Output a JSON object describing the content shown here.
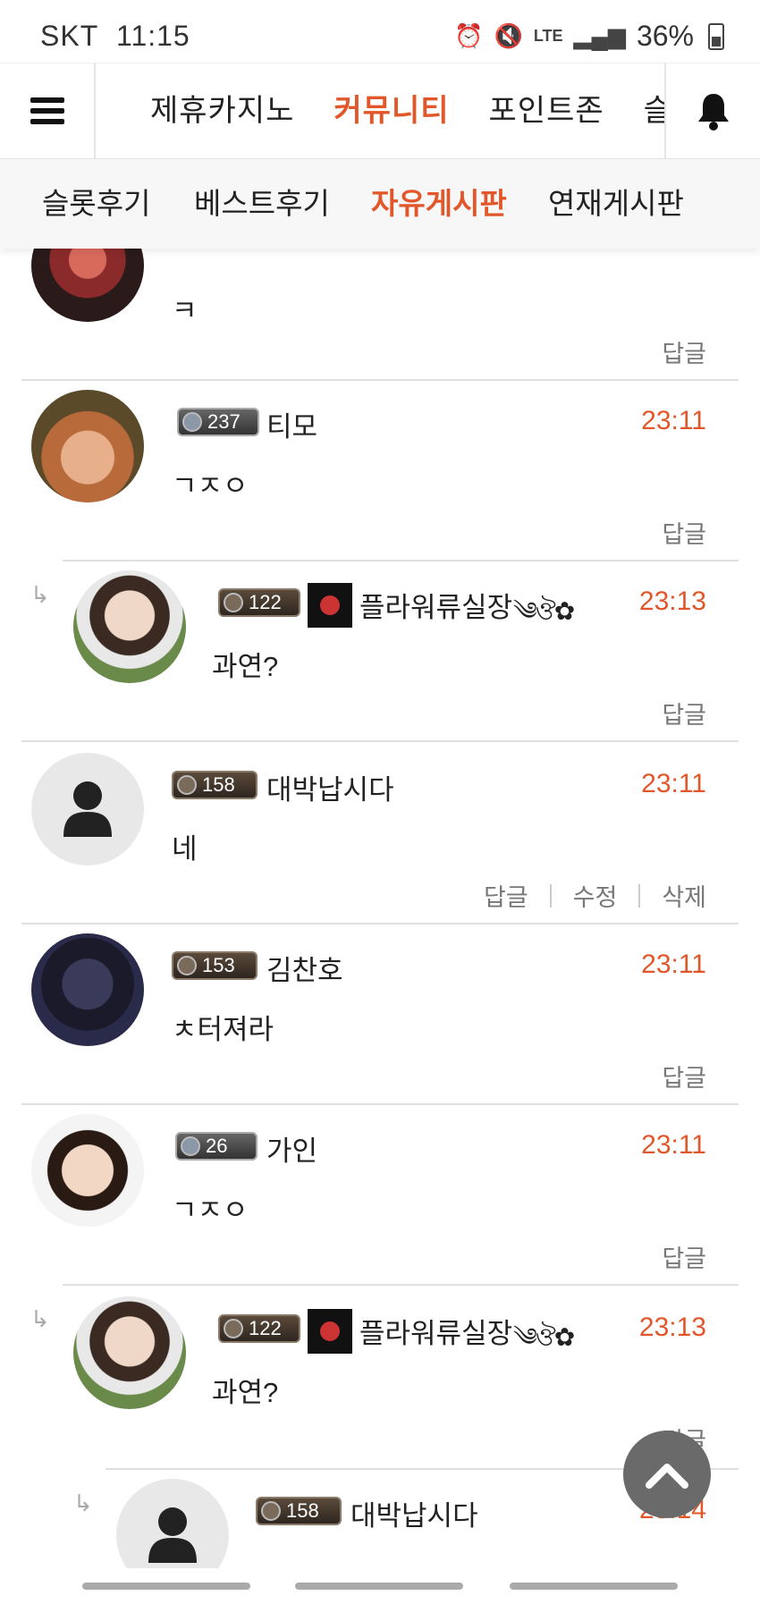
{
  "status_bar": {
    "carrier": "SKT",
    "time": "11:15",
    "battery": "36%",
    "network": "LTE"
  },
  "top_nav": {
    "items": [
      {
        "label": "제휴카지노",
        "active": false
      },
      {
        "label": "커뮤니티",
        "active": true
      },
      {
        "label": "포인트존",
        "active": false
      },
      {
        "label": "슬",
        "active": false
      }
    ]
  },
  "sub_nav": {
    "items": [
      {
        "label": "슬롯후기",
        "active": false
      },
      {
        "label": "베스트후기",
        "active": false
      },
      {
        "label": "자유게시판",
        "active": true
      },
      {
        "label": "연재게시판",
        "active": false
      }
    ]
  },
  "comments": [
    {
      "name": "",
      "badge_level": "",
      "time": "",
      "text": "ㅋ",
      "actions": [
        "답글"
      ]
    },
    {
      "name": "티모",
      "badge_level": "237",
      "time": "23:11",
      "text": "ㄱㅈㅇ",
      "actions": [
        "답글"
      ]
    },
    {
      "name": "플라워류실장",
      "badge_level": "122",
      "time": "23:13",
      "text": "과연?",
      "actions": [
        "답글"
      ],
      "reply": true
    },
    {
      "name": "대박납시다",
      "badge_level": "158",
      "time": "23:11",
      "text": "네",
      "actions": [
        "답글",
        "수정",
        "삭제"
      ]
    },
    {
      "name": "김찬호",
      "badge_level": "153",
      "time": "23:11",
      "text": "ㅊ터져라",
      "actions": [
        "답글"
      ]
    },
    {
      "name": "가인",
      "badge_level": "26",
      "time": "23:11",
      "text": "ㄱㅈㅇ",
      "actions": [
        "답글"
      ]
    },
    {
      "name": "플라워류실장",
      "badge_level": "122",
      "time": "23:13",
      "text": "과연?",
      "actions": [
        "답글"
      ],
      "reply": true
    },
    {
      "name": "대박납시다",
      "badge_level": "158",
      "time": "23:14",
      "text": "",
      "actions": [],
      "reply": true
    }
  ],
  "icons": {
    "menu": "hamburger-icon",
    "bell": "bell-icon",
    "reply": "reply-arrow-icon",
    "scroll_top": "chevron-up-icon",
    "default_avatar": "person-icon"
  },
  "colors": {
    "accent": "#e2572a",
    "divider": "#e0e0e0",
    "time": "#e2572a"
  }
}
